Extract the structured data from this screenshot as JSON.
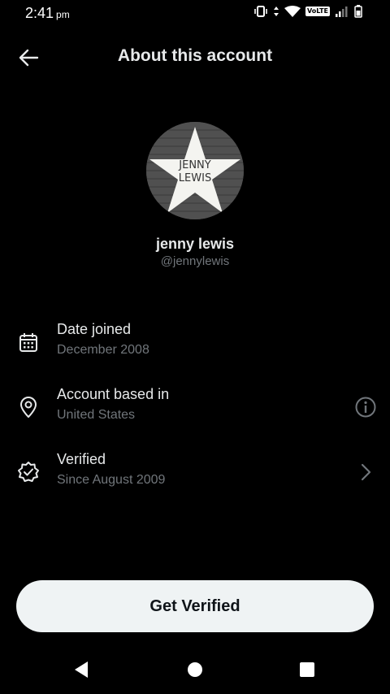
{
  "status_bar": {
    "time": "2:41",
    "ampm": "pm",
    "network_badge": "VoLTE"
  },
  "header": {
    "title": "About this account"
  },
  "profile": {
    "avatar_text_line1": "JENNY",
    "avatar_text_line2": "LEWIS",
    "name": "jenny lewis",
    "handle": "@jennylewis"
  },
  "details": [
    {
      "label": "Date joined",
      "value": "December 2008",
      "icon": "calendar-icon"
    },
    {
      "label": "Account based in",
      "value": "United States",
      "icon": "location-pin-icon",
      "trailing_icon": "info-icon"
    },
    {
      "label": "Verified",
      "value": "Since August 2009",
      "icon": "verified-badge-icon",
      "trailing_icon": "chevron-right-icon"
    }
  ],
  "footer": {
    "button_label": "Get Verified"
  },
  "colors": {
    "background": "#000000",
    "primary_text": "#e7e9ea",
    "secondary_text": "#71767b",
    "button_bg": "#eff3f4"
  }
}
